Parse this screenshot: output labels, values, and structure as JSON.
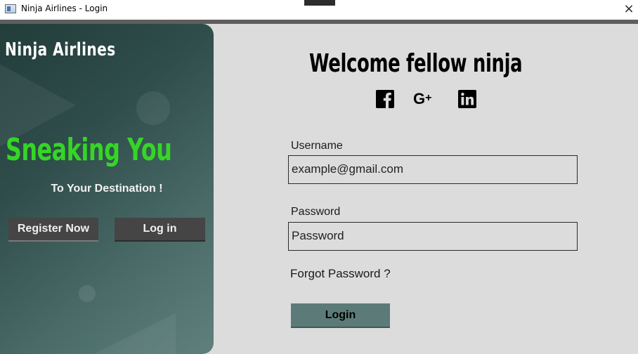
{
  "window": {
    "title": "Ninja Airlines - Login",
    "close_glyph": "×"
  },
  "left_panel": {
    "brand": "Ninja Airlines",
    "tagline": "Sneaking You",
    "subtagline": "To Your Destination !",
    "register_label": "Register Now",
    "login_label": "Log in",
    "accent_color": "#35d626"
  },
  "right_panel": {
    "heading": "Welcome fellow ninja",
    "social_icons": [
      "facebook-icon",
      "google-plus-icon",
      "linkedin-icon"
    ],
    "google_plus_text": "G",
    "google_plus_sup": "+",
    "username_label": "Username",
    "username_value": "example@gmail.com",
    "password_label": "Password",
    "password_value": "Password",
    "forgot_link": "Forgot Password ?",
    "submit_label": "Login",
    "submit_color": "#5c7b78"
  }
}
